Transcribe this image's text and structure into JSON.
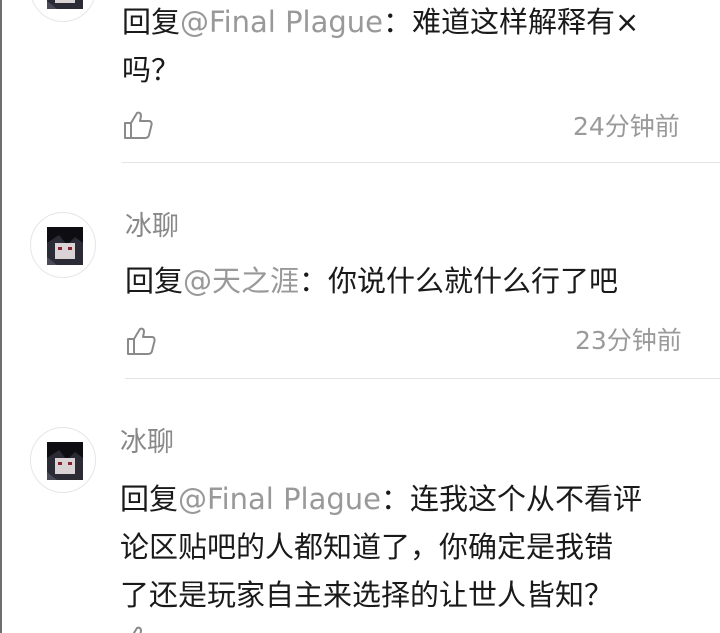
{
  "comments": [
    {
      "username": "",
      "reply_prefix": "回复",
      "mention": "@Final Plague",
      "separator": "：",
      "text_lines": [
        "难道这样解释有×",
        "吗？"
      ],
      "time": "24分钟前"
    },
    {
      "username": "冰聊",
      "reply_prefix": "回复",
      "mention": "@天之涯",
      "separator": "：",
      "text_lines": [
        "你说什么就什么行了吧"
      ],
      "time": "23分钟前"
    },
    {
      "username": "冰聊",
      "reply_prefix": "回复",
      "mention": "@Final Plague",
      "separator": "：",
      "text_lines": [
        "连我这个从不看评",
        "论区贴吧的人都知道了，你确定是我错",
        "了还是玩家自主来选择的让世人皆知？"
      ],
      "time": ""
    }
  ],
  "icons": {
    "like": "thumbs-up-icon",
    "avatar": "anime-avatar"
  },
  "colors": {
    "username": "#888888",
    "mention": "#999999",
    "body_text": "#1a1a1a",
    "time": "#9a9a9a",
    "divider": "#e3e3e3"
  }
}
